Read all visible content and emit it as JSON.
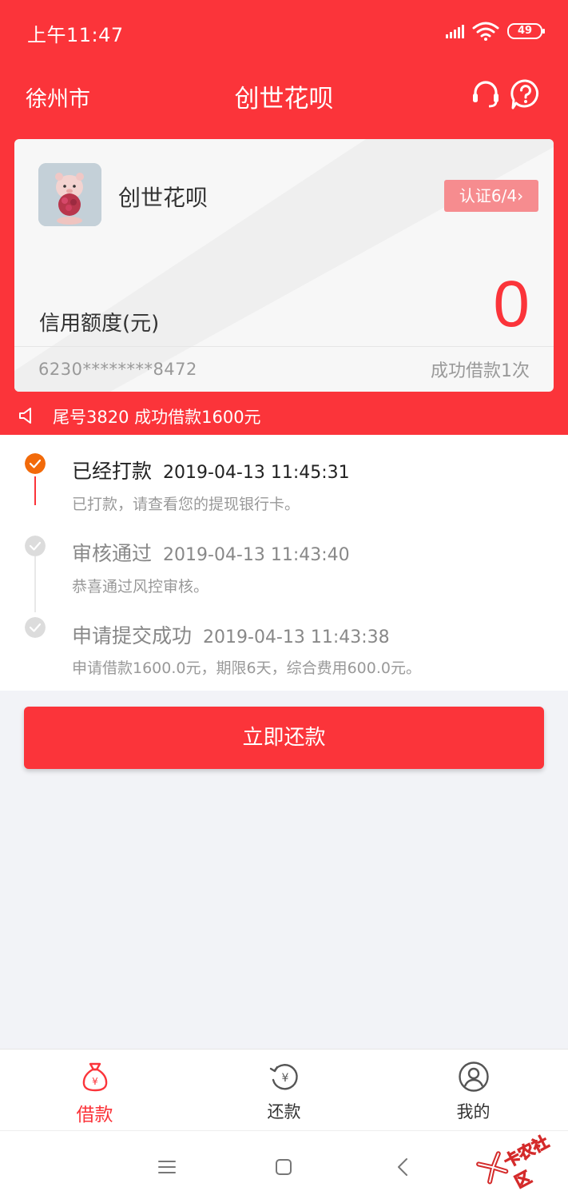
{
  "status_bar": {
    "time": "上午11:47",
    "battery": "49"
  },
  "nav": {
    "city": "徐州市",
    "title": "创世花呗"
  },
  "card": {
    "name": "创世花呗",
    "cert_badge": "认证6/4",
    "credit_label": "信用额度(元)",
    "credit_value": "0",
    "card_number": "6230********8472",
    "loan_count": "成功借款1次"
  },
  "notice": {
    "text": "尾号3820 成功借款1600元"
  },
  "timeline": [
    {
      "title": "已经打款",
      "time": "2019-04-13 11:45:31",
      "desc": "已打款，请查看您的提现银行卡。"
    },
    {
      "title": "审核通过",
      "time": "2019-04-13 11:43:40",
      "desc": "恭喜通过风控审核。"
    },
    {
      "title": "申请提交成功",
      "time": "2019-04-13 11:43:38",
      "desc": "申请借款1600.0元，期限6天，综合费用600.0元。"
    }
  ],
  "repay_button": "立即还款",
  "tabs": [
    {
      "label": "借款",
      "icon": "money-bag-icon",
      "active": true
    },
    {
      "label": "还款",
      "icon": "repay-icon",
      "active": false
    },
    {
      "label": "我的",
      "icon": "profile-icon",
      "active": false
    }
  ],
  "watermark": {
    "text": "卡农社区"
  },
  "colors": {
    "accent": "#fb343a",
    "active_dot": "#f26a0a",
    "inactive_dot": "#dcdcdc"
  }
}
